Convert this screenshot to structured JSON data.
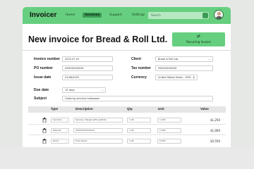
{
  "app": {
    "name": "Invoicer"
  },
  "nav": [
    {
      "label": "Home",
      "active": false
    },
    {
      "label": "Invoices",
      "active": true
    },
    {
      "label": "Support",
      "active": false
    },
    {
      "label": "Settings",
      "active": false
    }
  ],
  "search": {
    "placeholder": "Search"
  },
  "page": {
    "title": "New invoice for Bread & Roll Ltd."
  },
  "recurring": {
    "icon": "repeat-icon",
    "label": "Recurring Invoice"
  },
  "form": {
    "invoice_number": {
      "label": "Invoice number",
      "value": "2022-07-01"
    },
    "po_number": {
      "label": "PO number",
      "value": "XXXXXXXXXXX"
    },
    "issue_date": {
      "label": "Issue date",
      "value": "01/06/2022"
    },
    "client": {
      "label": "Client",
      "value": "Bread & Roll Ltd."
    },
    "tax_number": {
      "label": "Tax number",
      "value": "XXXXXXXXXXX"
    },
    "currency": {
      "label": "Currency",
      "value": "United States Dollar - USD - $"
    },
    "due_date": {
      "label": "Due date",
      "value": "15 days"
    },
    "subject": {
      "label": "Subject",
      "value": "Catering services halloween"
    }
  },
  "table": {
    "headers": {
      "type": "Type",
      "description": "Description",
      "qty": "Qty.",
      "unit": "Unit",
      "value": "Value"
    },
    "rows": [
      {
        "type": "Services",
        "description": "Service charges with gratuity",
        "qty": "1.00",
        "unit": "1,250",
        "value": "$1,250"
      },
      {
        "type": "Deposit",
        "description": "XXXXXXXXXXXXX",
        "qty": "1.00",
        "unit": "1,000",
        "value": "$1,000"
      },
      {
        "type": "Items",
        "description": "Food items",
        "qty": "1.00",
        "unit": "5,550",
        "value": "$5,550"
      }
    ]
  },
  "colors": {
    "accent": "#66cf7f",
    "accent_dark": "#3a9b54"
  }
}
